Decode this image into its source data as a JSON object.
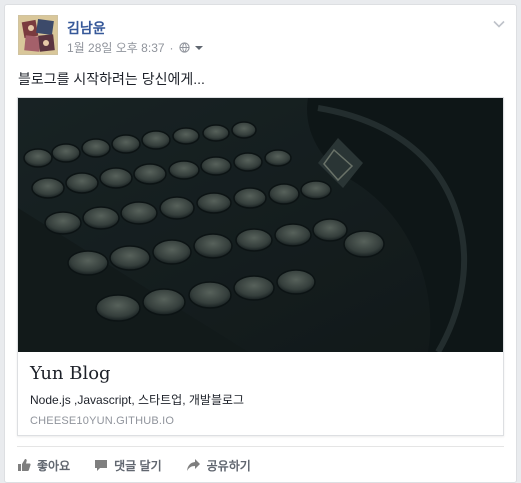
{
  "post": {
    "author": "김남윤",
    "date": "1월 28일 오후 8:37",
    "separator": "·",
    "audience_icon": "globe-icon",
    "text": "블로그를 시작하려는 당신에게...",
    "options_icon": "chevron-down-icon"
  },
  "link": {
    "title": "Yun Blog",
    "description": "Node.js ,Javascript, 스타트업, 개발블로그",
    "domain": "CHEESE10YUN.GITHUB.IO",
    "image": "typewriter-photo"
  },
  "actions": [
    {
      "label": "좋아요",
      "icon": "like-icon"
    },
    {
      "label": "댓글 달기",
      "icon": "comment-icon"
    },
    {
      "label": "공유하기",
      "icon": "share-icon"
    }
  ],
  "colors": {
    "author_link": "#365899",
    "meta_gray": "#90949c",
    "action_gray": "#616770",
    "background": "#e9ebee"
  }
}
